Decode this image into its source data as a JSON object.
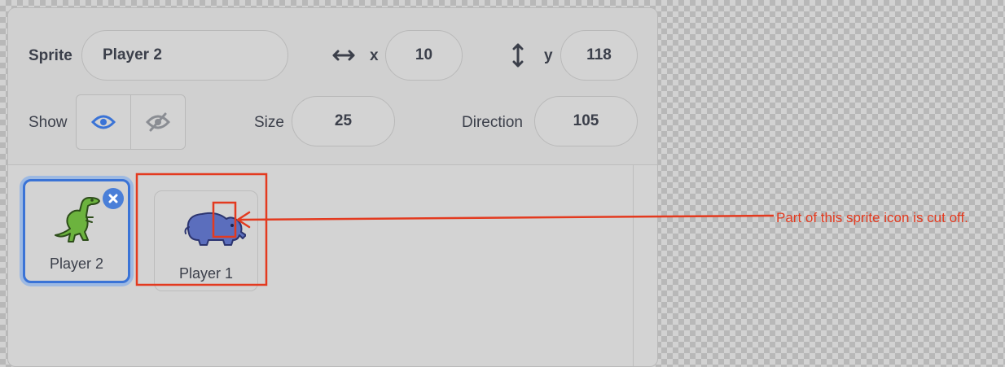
{
  "sprite_info": {
    "sprite_label": "Sprite",
    "sprite_name": "Player 2",
    "x_label": "x",
    "x_value": "10",
    "y_label": "y",
    "y_value": "118",
    "show_label": "Show",
    "size_label": "Size",
    "size_value": "25",
    "direction_label": "Direction",
    "direction_value": "105"
  },
  "sprites": [
    {
      "name": "Player 2",
      "icon": "dinosaur-icon",
      "selected": true
    },
    {
      "name": "Player 1",
      "icon": "elephant-icon",
      "selected": false
    }
  ],
  "annotation": {
    "text": "Part of this sprite icon is cut off."
  },
  "colors": {
    "accent": "#4c97ff",
    "annotation": "#e33a1f",
    "text": "#3b3f4a"
  }
}
